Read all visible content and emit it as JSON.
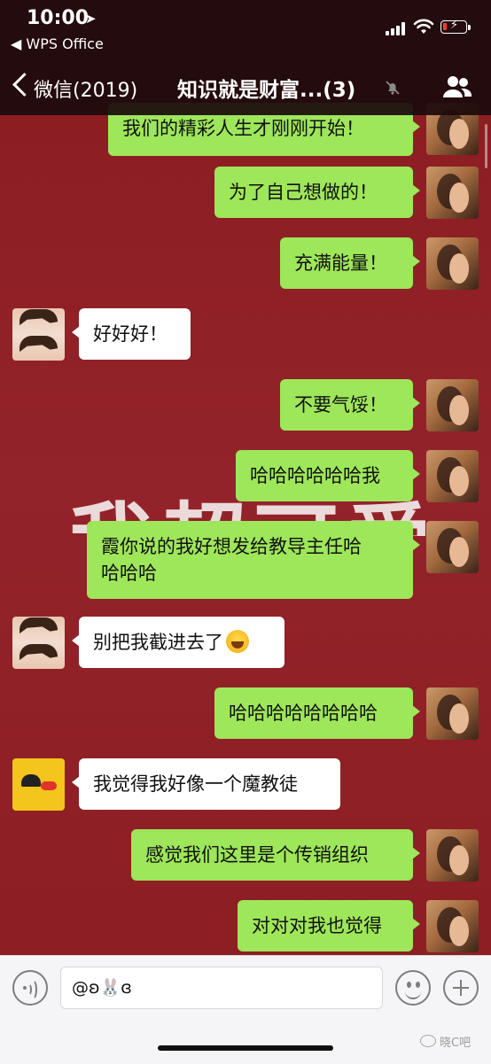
{
  "status_bar": {
    "time": "10:00",
    "back_app": "◀ WPS Office"
  },
  "nav": {
    "back_label": "微信(2019)",
    "title": "知识就是财富...(3)"
  },
  "wallpaper_text": "我超可爱",
  "messages": [
    {
      "side": "out",
      "text": "我们的精彩人生才刚刚开始！"
    },
    {
      "side": "out",
      "text": "为了自己想做的！"
    },
    {
      "side": "out",
      "text": "充满能量！"
    },
    {
      "side": "in",
      "text": "好好好！"
    },
    {
      "side": "out",
      "text": "不要气馁！"
    },
    {
      "side": "out",
      "text": "哈哈哈哈哈哈我"
    },
    {
      "side": "out",
      "text": "霞你说的我好想发给教导主任哈\n哈哈哈"
    },
    {
      "side": "in",
      "text": "别把我截进去了"
    },
    {
      "side": "out",
      "text": "哈哈哈哈哈哈哈哈"
    },
    {
      "side": "in",
      "text": "我觉得我好像一个魔教徒"
    },
    {
      "side": "out",
      "text": "感觉我们这里是个传销组织"
    },
    {
      "side": "out",
      "text": "对对对我也觉得"
    }
  ],
  "input": {
    "value": "@ʚ🐰ɞ"
  },
  "watermark": "晓C吧",
  "colors": {
    "outgoing_bubble": "#9ee65a",
    "incoming_bubble": "#ffffff",
    "background": "#8e1f23"
  }
}
